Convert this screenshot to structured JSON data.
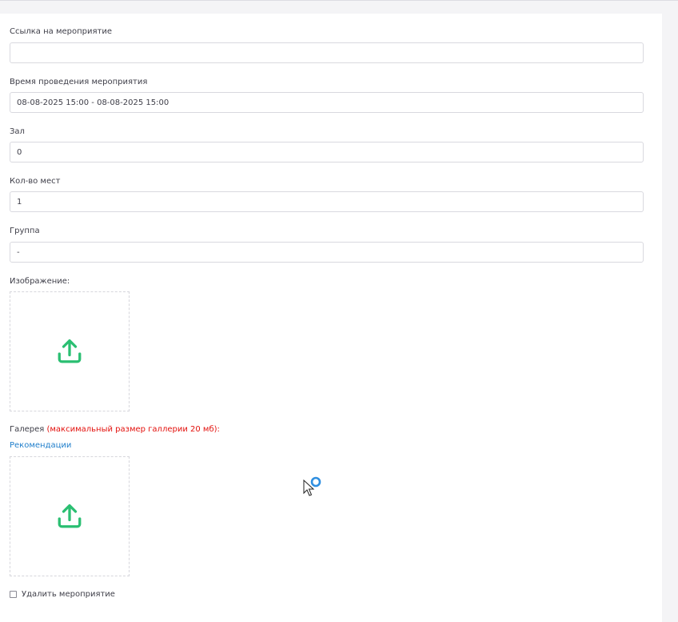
{
  "form": {
    "event_link": {
      "label": "Ссылка на мероприятие",
      "value": ""
    },
    "event_time": {
      "label": "Время проведения мероприятия",
      "value": "08-08-2025 15:00 - 08-08-2025 15:00"
    },
    "hall": {
      "label": "Зал",
      "value": "0"
    },
    "seats": {
      "label": "Кол-во мест",
      "value": "1"
    },
    "group": {
      "label": "Группа",
      "value": "-"
    },
    "image": {
      "label": "Изображение:",
      "icon": "upload-icon"
    },
    "gallery": {
      "label": "Галерея",
      "warning": "(максимальный размер галлерии 20 мб):",
      "recommendations_link": "Рекомендации",
      "icon": "upload-icon"
    },
    "delete_event": {
      "label": "Удалить мероприятие",
      "checked": false
    }
  },
  "colors": {
    "upload_icon": "#2bbf72",
    "warning": "#e3110d",
    "link": "#1f7ecb",
    "cursor_ring": "#2f8fe0"
  }
}
